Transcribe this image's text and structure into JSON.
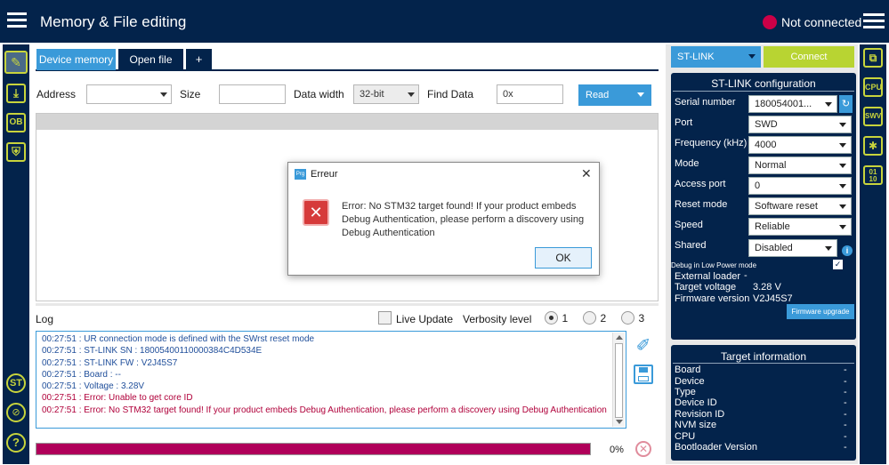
{
  "header": {
    "title": "Memory & File editing",
    "status": "Not connected"
  },
  "tabs": [
    {
      "label": "Device memory"
    },
    {
      "label": "Open file"
    },
    {
      "label": "+"
    }
  ],
  "toolbar": {
    "address_label": "Address",
    "address_value": "",
    "size_label": "Size",
    "size_value": "",
    "width_label": "Data width",
    "width_value": "32-bit",
    "find_label": "Find Data",
    "find_value": "0x",
    "read_label": "Read"
  },
  "dialog": {
    "title": "Erreur",
    "app_badge": "Prg",
    "message": "Error: No STM32 target found! If your product embeds Debug Authentication, please perform a discovery using Debug Authentication",
    "ok": "OK"
  },
  "log": {
    "title": "Log",
    "live_update": "Live Update",
    "verbosity_label": "Verbosity level",
    "levels": [
      "1",
      "2",
      "3"
    ],
    "selected_level": "1",
    "lines": [
      {
        "text": "00:27:51 : UR connection mode is defined with the SWrst reset mode",
        "type": "info"
      },
      {
        "text": "00:27:51 : ST-LINK SN  : 18005400110000384C4D534E",
        "type": "info"
      },
      {
        "text": "00:27:51 : ST-LINK FW  : V2J45S7",
        "type": "info"
      },
      {
        "text": "00:27:51 : Board       : --",
        "type": "info"
      },
      {
        "text": "00:27:51 : Voltage     : 3.28V",
        "type": "info"
      },
      {
        "text": "00:27:51 : Error: Unable to get core ID",
        "type": "error"
      },
      {
        "text": "00:27:51 : Error: No STM32 target found! If your product embeds Debug Authentication, please perform a discovery using Debug Authentication",
        "type": "error"
      }
    ]
  },
  "progress": {
    "value": "0%",
    "fraction": 1.0
  },
  "right_panel": {
    "interface": "ST-LINK",
    "connect_label": "Connect",
    "config_title": "ST-LINK configuration",
    "fields": [
      {
        "label": "Serial number",
        "value": "180054001..."
      },
      {
        "label": "Port",
        "value": "SWD"
      },
      {
        "label": "Frequency (kHz)",
        "value": "4000"
      },
      {
        "label": "Mode",
        "value": "Normal"
      },
      {
        "label": "Access port",
        "value": "0"
      },
      {
        "label": "Reset mode",
        "value": "Software reset"
      },
      {
        "label": "Speed",
        "value": "Reliable"
      },
      {
        "label": "Shared",
        "value": "Disabled"
      }
    ],
    "debug_low_power": "Debug in Low Power mode",
    "external_loader_label": "External loader",
    "external_loader_value": "-",
    "target_voltage_label": "Target voltage",
    "target_voltage_value": "3.28 V",
    "firmware_version_label": "Firmware version",
    "firmware_version_value": "V2J45S7",
    "firmware_upgrade": "Firmware upgrade"
  },
  "target_info": {
    "title": "Target information",
    "rows": [
      {
        "label": "Board",
        "value": "-"
      },
      {
        "label": "Device",
        "value": "-"
      },
      {
        "label": "Type",
        "value": "-"
      },
      {
        "label": "Device ID",
        "value": "-"
      },
      {
        "label": "Revision ID",
        "value": "-"
      },
      {
        "label": "NVM size",
        "value": "-"
      },
      {
        "label": "CPU",
        "value": "-"
      },
      {
        "label": "Bootloader Version",
        "value": "-"
      }
    ]
  },
  "sidebar_icons": [
    "edit-icon",
    "download-icon",
    "option-bytes-icon",
    "security-icon"
  ],
  "sidebar_icon_labels": {
    "ob": "OB"
  },
  "right_icons": {
    "cpu": "CPU",
    "swv": "SWV",
    "bin": "01\n10"
  },
  "colors": {
    "navy": "#03234b",
    "accent": "#3399dd",
    "green": "#b8d432",
    "error": "#b0003a",
    "status_dot": "#cc0047"
  }
}
